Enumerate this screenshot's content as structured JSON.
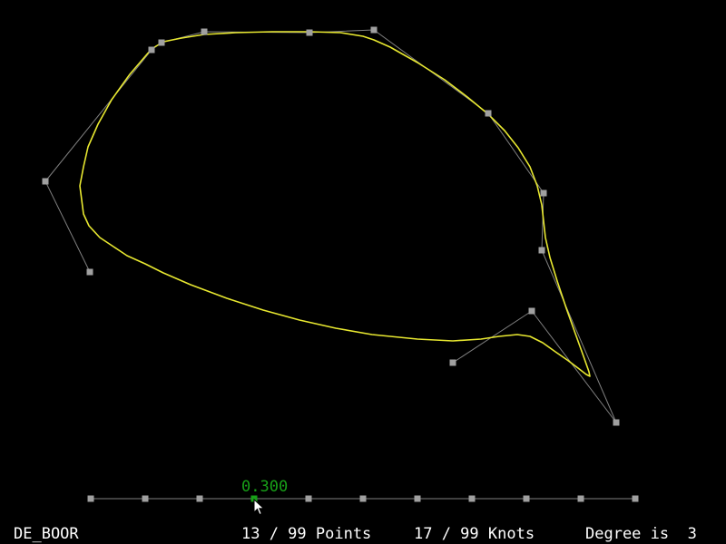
{
  "status": {
    "mode": "DE_BOOR",
    "points_text": "13 / 99 Points",
    "knots_text": "17 / 99 Knots",
    "degree_text": "Degree is  3"
  },
  "knot_slider": {
    "selected_value_label": "0.300",
    "selected_index": 3,
    "knot_count": 11
  },
  "colors": {
    "background": "#000000",
    "curve": "#e8e830",
    "control_polygon": "#808080",
    "control_point": "#a0a0a0",
    "selected_knot": "#18a018",
    "text": "#ffffff"
  }
}
